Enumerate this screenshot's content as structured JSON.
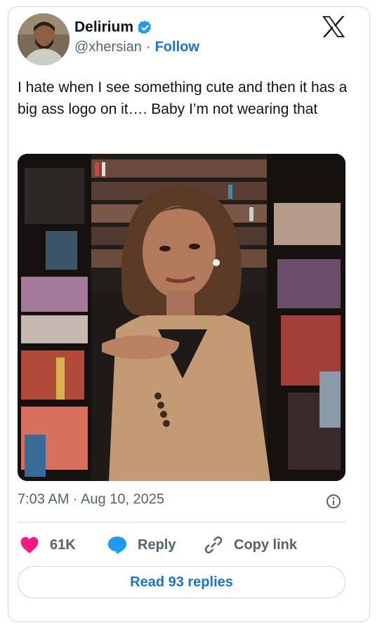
{
  "author": {
    "display_name": "Delirium",
    "handle": "@xhersian",
    "separator": "·",
    "follow_label": "Follow"
  },
  "tweet": {
    "text": "I hate when I see something cute and then it has a big ass logo on it…. Baby I’m not wearing that",
    "timestamp": "7:03 AM · Aug 10, 2025"
  },
  "actions": {
    "like_count": "61K",
    "reply_label": "Reply",
    "copy_link_label": "Copy link"
  },
  "read_replies_label": "Read 93 replies",
  "icons": {
    "verified": "verified-badge-icon",
    "brand": "x-logo-icon",
    "like": "heart-icon",
    "reply": "speech-bubble-icon",
    "copy": "link-icon",
    "info": "info-icon"
  },
  "colors": {
    "link_blue": "#1d73c9",
    "verified_blue": "#1d9bf0",
    "like_pink": "#f91880",
    "text_primary": "#0f1419",
    "text_secondary": "#536471",
    "border": "#cfd9de"
  }
}
